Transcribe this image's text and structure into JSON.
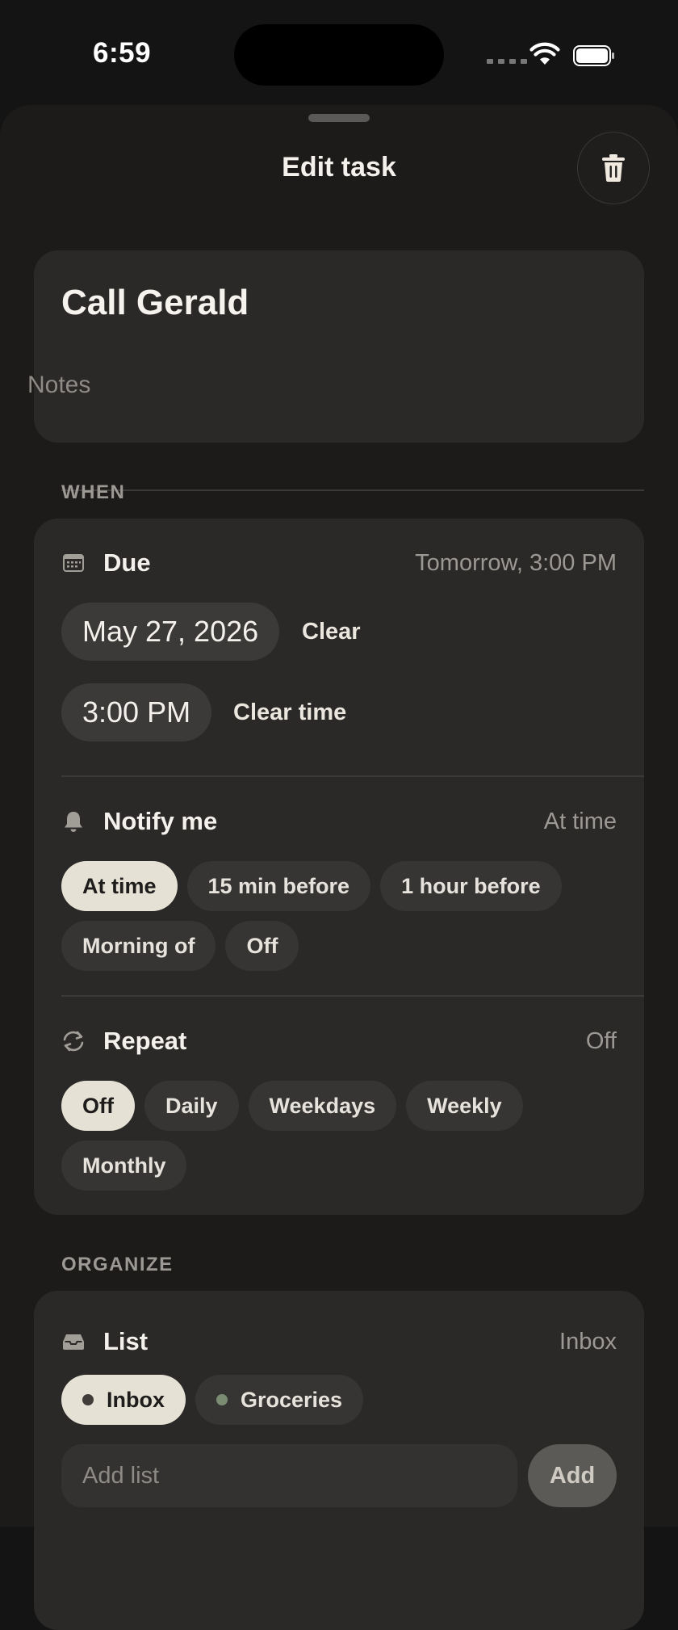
{
  "status_bar": {
    "time": "6:59"
  },
  "sheet": {
    "title": "Edit task"
  },
  "task": {
    "title": "Call Gerald",
    "notes_placeholder": "Notes"
  },
  "when": {
    "section_label": "WHEN",
    "due": {
      "label": "Due",
      "value": "Tomorrow, 3:00 PM",
      "date": "May 27, 2026",
      "clear_label": "Clear",
      "time": "3:00 PM",
      "clear_time_label": "Clear time"
    },
    "notify": {
      "label": "Notify me",
      "value": "At time",
      "options": [
        "At time",
        "15 min before",
        "1 hour before",
        "Morning of",
        "Off"
      ],
      "selected": "At time"
    },
    "repeat": {
      "label": "Repeat",
      "value": "Off",
      "options": [
        "Off",
        "Daily",
        "Weekdays",
        "Weekly",
        "Monthly"
      ],
      "selected": "Off"
    }
  },
  "organize": {
    "section_label": "ORGANIZE",
    "list": {
      "label": "List",
      "value": "Inbox",
      "options": [
        {
          "label": "Inbox",
          "dot_color": "#3f3c39"
        },
        {
          "label": "Groceries",
          "dot_color": "#7a8c72"
        }
      ],
      "selected": "Inbox",
      "add_placeholder": "Add list",
      "add_button": "Add"
    }
  },
  "icons": {
    "delete": "trash-icon",
    "due": "calendar-icon",
    "notify": "bell-icon",
    "repeat": "repeat-icon",
    "list": "tray-icon"
  },
  "colors": {
    "background": "#151414",
    "sheet": "#1c1b1a",
    "card": "#2a2928",
    "chip": "#363533",
    "chip_selected": "#e6e1d5",
    "muted_text": "#9c9893"
  }
}
